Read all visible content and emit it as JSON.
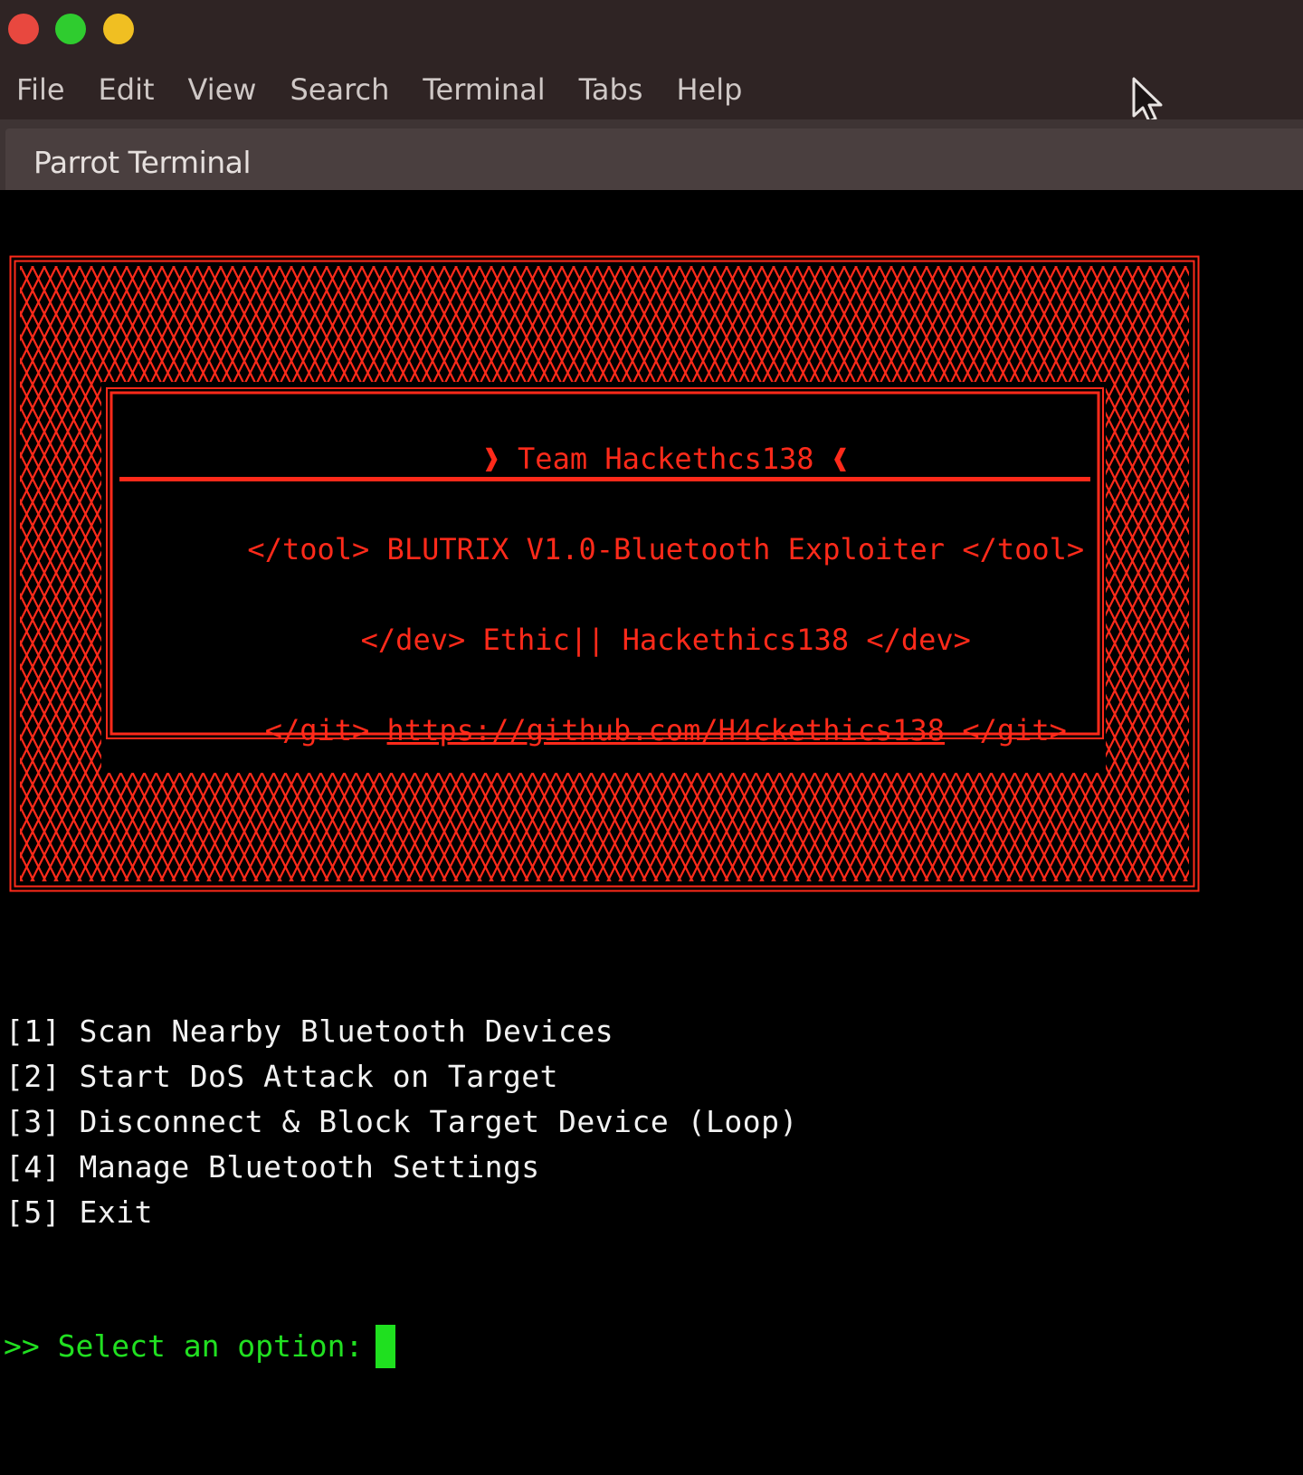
{
  "window": {
    "menu": [
      "File",
      "Edit",
      "View",
      "Search",
      "Terminal",
      "Tabs",
      "Help"
    ],
    "tab_title": "Parrot Terminal",
    "traffic_lights": {
      "close": "#e8483f",
      "maximize": "#2fcc2f",
      "minimize": "#f0bf22"
    }
  },
  "banner": {
    "color": "#ff2a1a",
    "team": "❱ Team Hackethcs138 ❰",
    "tool_tag": "</tool>",
    "tool_name": "BLUTRIX V1.0-Bluetooth Exploiter",
    "dev_tag": "</dev>",
    "dev_name": "Ethic|| Hackethics138",
    "git_tag": "</git>",
    "git_url": "https://github.com/H4ckethics138"
  },
  "menu_options": [
    {
      "key": "[1]",
      "label": "Scan Nearby Bluetooth Devices"
    },
    {
      "key": "[2]",
      "label": "Start DoS Attack on Target"
    },
    {
      "key": "[3]",
      "label": "Disconnect & Block Target Device (Loop)"
    },
    {
      "key": "[4]",
      "label": "Manage Bluetooth Settings"
    },
    {
      "key": "[5]",
      "label": "Exit"
    }
  ],
  "prompt": {
    "symbol": ">>",
    "text": "Select an option:",
    "color": "#21e021"
  }
}
